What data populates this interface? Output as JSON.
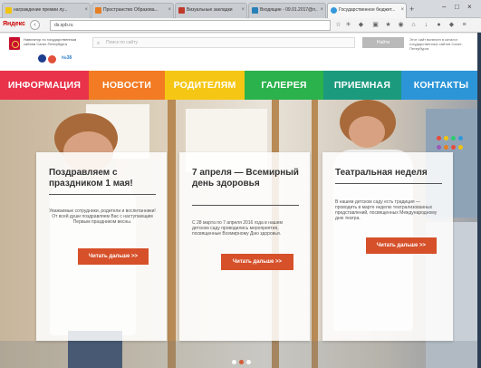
{
  "browser": {
    "tabs": [
      {
        "label": "награждение премии лу...",
        "icon": "yellow-tab-icon",
        "color": "#f1c40f",
        "active": false
      },
      {
        "label": "Пространство Образова...",
        "icon": "red-tab-icon",
        "color": "#e67e22",
        "active": false
      },
      {
        "label": "Визуальные закладки",
        "icon": "bookmarks-icon",
        "color": "#c0392b",
        "active": false
      },
      {
        "label": "Входящие - 09.01.2017@п...",
        "icon": "mail-icon",
        "color": "#2980b9",
        "active": false
      },
      {
        "label": "Государственное бюджет...",
        "icon": "site-icon",
        "color": "#3498db",
        "active": true
      }
    ],
    "yandex_label": "Яндекс",
    "url": "ds.spb.ru"
  },
  "site_header": {
    "portal_text": "Навигатор по государственным сайтам Санкт-Петербурга",
    "search_placeholder": "Поиск по сайту",
    "find_button": "Найти",
    "official_text": "Этот сайт включен в каталог государственных сайтов Санкт-Петербурга",
    "logo_number": "№38"
  },
  "menu": [
    {
      "label": "ИНФОРМАЦИЯ",
      "color": "#e8334a"
    },
    {
      "label": "НОВОСТИ",
      "color": "#f27b23"
    },
    {
      "label": "РОДИТЕЛЯМ",
      "color": "#f6c614"
    },
    {
      "label": "ГАЛЕРЕЯ",
      "color": "#2bb24c"
    },
    {
      "label": "ПРИЕМНАЯ",
      "color": "#1b9a7e"
    },
    {
      "label": "КОНТАКТЫ",
      "color": "#2c95d8"
    }
  ],
  "cards": [
    {
      "title": "Поздравляем с праздником 1 мая!",
      "text": "Уважаемые сотрудники, родители и воспитанники! От всей души поздравляем Вас с наступающим Первым праздником весны.",
      "button": "Читать дальше >>"
    },
    {
      "title": "7 апреля — Всемирный день здоровья",
      "text": "С 28 марта по 7 апреля 2016 года в нашем детском саду проводились мероприятия, посвященные Всемирному Дню здоровья.",
      "button": "Читать дальше >>"
    },
    {
      "title": "Театральная неделя",
      "text": "В нашем детском саду есть традиция — проводить в марте неделю театрализованных представлений, посвященных Международному дню театра.",
      "button": "Читать дальше >>"
    }
  ],
  "slider": {
    "slides": 3,
    "active_slide": 1
  }
}
